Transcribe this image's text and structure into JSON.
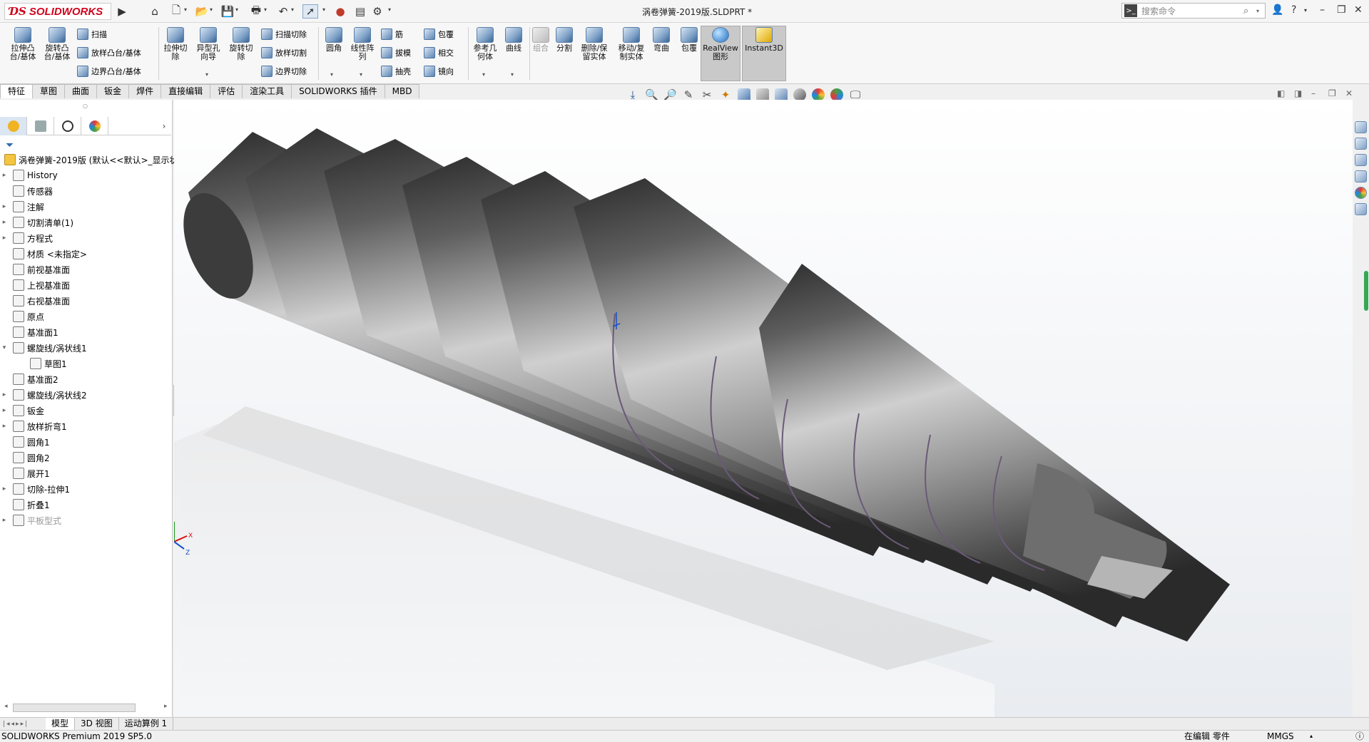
{
  "app": {
    "brand": "SOLIDWORKS",
    "title": "涡卷弹簧-2019版.SLDPRT *"
  },
  "search": {
    "placeholder": "搜索命令"
  },
  "commands": {
    "extrude_boss": "拉伸凸\n台/基体",
    "revolve_boss": "旋转凸\n台/基体",
    "sweep": "扫描",
    "loft_boss": "放样凸台/基体",
    "boundary_boss": "边界凸台/基体",
    "extrude_cut": "拉伸切\n除",
    "hole_wizard": "异型孔\n向导",
    "revolve_cut": "旋转切\n除",
    "swept_cut": "扫描切除",
    "lofted_cut": "放样切割",
    "boundary_cut": "边界切除",
    "fillet": "圆角",
    "linear_pattern": "线性阵\n列",
    "rib": "筋",
    "draft": "拔模",
    "shell": "抽壳",
    "wrap": "包覆",
    "intersect": "相交",
    "mirror": "镜向",
    "ref_geometry": "参考几\n何体",
    "curves": "曲线",
    "combine": "组合",
    "split": "分割",
    "delete_keep": "删除/保\n留实体",
    "move_copy": "移动/复\n制实体",
    "flex": "弯曲",
    "wrap2": "包覆",
    "realview": "RealView\n图形",
    "instant3d": "Instant3D"
  },
  "tabs": [
    "特征",
    "草图",
    "曲面",
    "钣金",
    "焊件",
    "直接编辑",
    "评估",
    "渲染工具",
    "SOLIDWORKS 插件",
    "MBD"
  ],
  "tree": {
    "root": "涡卷弹簧-2019版  (默认<<默认>_显示状",
    "items": [
      {
        "label": "History",
        "expand": true
      },
      {
        "label": "传感器",
        "expand": false
      },
      {
        "label": "注解",
        "expand": true
      },
      {
        "label": "切割清单(1)",
        "expand": true
      },
      {
        "label": "方程式",
        "expand": true
      },
      {
        "label": "材质 <未指定>",
        "expand": false
      },
      {
        "label": "前视基准面",
        "expand": false
      },
      {
        "label": "上视基准面",
        "expand": false
      },
      {
        "label": "右视基准面",
        "expand": false
      },
      {
        "label": "原点",
        "expand": false
      },
      {
        "label": "基准面1",
        "expand": false
      },
      {
        "label": "螺旋线/涡状线1",
        "expand": "open"
      },
      {
        "label": "草图1",
        "expand": false,
        "indent": true
      },
      {
        "label": "基准面2",
        "expand": false
      },
      {
        "label": "螺旋线/涡状线2",
        "expand": true
      },
      {
        "label": "钣金",
        "expand": true
      },
      {
        "label": "放样折弯1",
        "expand": true
      },
      {
        "label": "圆角1",
        "expand": false
      },
      {
        "label": "圆角2",
        "expand": false
      },
      {
        "label": "展开1",
        "expand": false
      },
      {
        "label": "切除-拉伸1",
        "expand": true
      },
      {
        "label": "折叠1",
        "expand": false
      },
      {
        "label": "平板型式",
        "expand": true,
        "greyed": true
      }
    ]
  },
  "bottom_tabs": [
    "模型",
    "3D 视图",
    "运动算例 1"
  ],
  "status": {
    "product": "SOLIDWORKS Premium 2019 SP5.0",
    "editing": "在编辑 零件",
    "units": "MMGS"
  }
}
